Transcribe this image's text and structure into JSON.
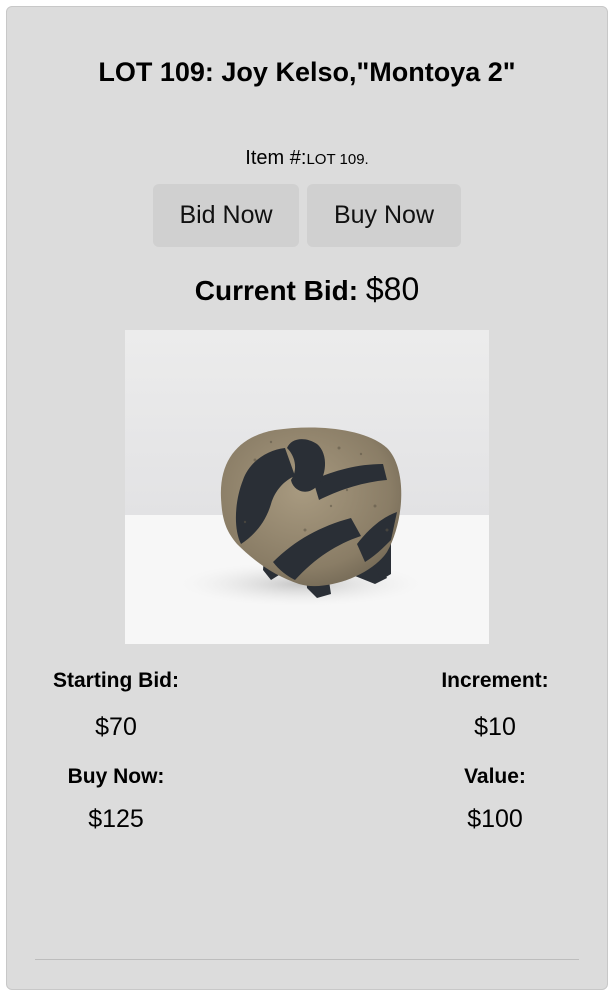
{
  "lot": {
    "title": "LOT 109: Joy Kelso,\"Montoya 2\"",
    "item_number_label": "Item #:",
    "item_number_value": "LOT 109."
  },
  "actions": {
    "bid_now_label": "Bid Now",
    "buy_now_label": "Buy Now"
  },
  "current_bid": {
    "label": "Current Bid:",
    "amount": "$80"
  },
  "image": {
    "alt": "ceramic bison sculpture"
  },
  "stats": {
    "starting_bid_label": "Starting Bid:",
    "starting_bid_value": "$70",
    "increment_label": "Increment:",
    "increment_value": "$10",
    "buy_now_label": "Buy Now:",
    "buy_now_value": "$125",
    "value_label": "Value:",
    "value_value": "$100"
  },
  "colors": {
    "card_background": "#dcdcdc",
    "button_background": "#d0d0d0"
  }
}
